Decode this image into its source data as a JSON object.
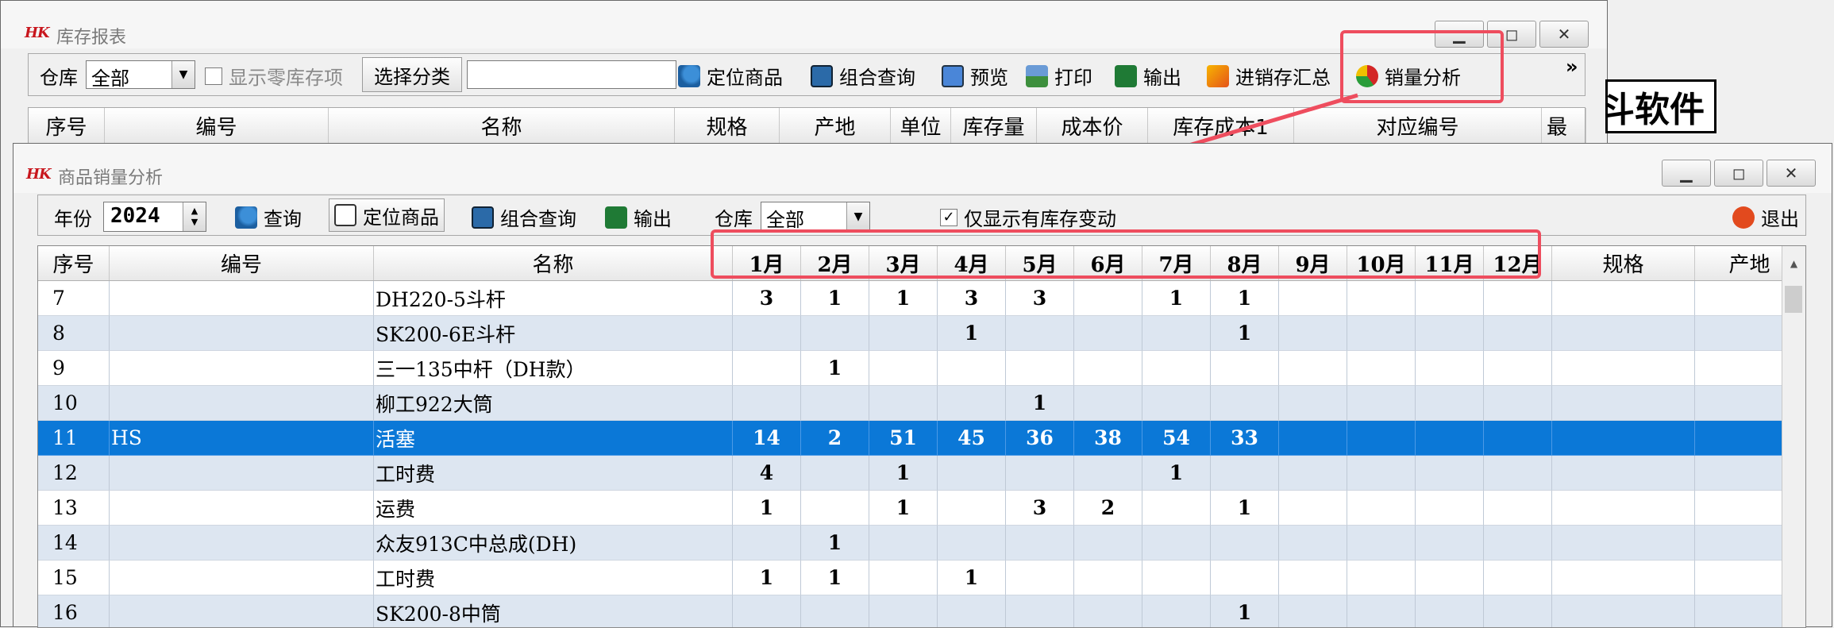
{
  "inventory_window": {
    "logo": "HK",
    "title": "库存报表",
    "toolbar": {
      "warehouse_label": "仓库",
      "warehouse_value": "全部",
      "show_zero_label": "显示零库存项",
      "choose_category": "选择分类",
      "category_value": "",
      "locate": "定位商品",
      "combo_query": "组合查询",
      "preview": "预览",
      "print": "打印",
      "export": "输出",
      "summary": "进销存汇总",
      "sales_analysis": "销量分析",
      "more": "»"
    },
    "columns": [
      "序号",
      "编号",
      "名称",
      "规格",
      "产地",
      "单位",
      "库存量",
      "成本价",
      "库存成本1",
      "对应编号",
      "最"
    ],
    "brand_text": "斗软件"
  },
  "sales_window": {
    "logo": "HK",
    "title": "商品销量分析",
    "toolbar": {
      "year_label": "年份",
      "year_value": "2024",
      "query": "查询",
      "locate": "定位商品",
      "combo_query": "组合查询",
      "export": "输出",
      "warehouse_label": "仓库",
      "warehouse_value": "全部",
      "only_changed_label": "仅显示有库存变动",
      "only_changed_checked": true,
      "exit": "退出"
    },
    "columns": {
      "index": "序号",
      "code": "编号",
      "name": "名称",
      "months": [
        "1月",
        "2月",
        "3月",
        "4月",
        "5月",
        "6月",
        "7月",
        "8月",
        "9月",
        "10月",
        "11月",
        "12月"
      ],
      "spec": "规格",
      "origin": "产地"
    },
    "rows": [
      {
        "index": "7",
        "code": "",
        "name": "DH220-5斗杆",
        "m": [
          "3",
          "1",
          "1",
          "3",
          "3",
          "",
          "1",
          "1",
          "",
          "",
          "",
          ""
        ]
      },
      {
        "index": "8",
        "code": "",
        "name": "SK200-6E斗杆",
        "m": [
          "",
          "",
          "",
          "1",
          "",
          "",
          "",
          "1",
          "",
          "",
          "",
          ""
        ]
      },
      {
        "index": "9",
        "code": "",
        "name": "三一135中杆（DH款）",
        "m": [
          "",
          "1",
          "",
          "",
          "",
          "",
          "",
          "",
          "",
          "",
          "",
          ""
        ]
      },
      {
        "index": "10",
        "code": "",
        "name": "柳工922大筒",
        "m": [
          "",
          "",
          "",
          "",
          "1",
          "",
          "",
          "",
          "",
          "",
          "",
          ""
        ]
      },
      {
        "index": "11",
        "code": "HS",
        "name": "活塞",
        "m": [
          "14",
          "2",
          "51",
          "45",
          "36",
          "38",
          "54",
          "33",
          "",
          "",
          "",
          ""
        ],
        "selected": true
      },
      {
        "index": "12",
        "code": "",
        "name": "工时费",
        "m": [
          "4",
          "",
          "1",
          "",
          "",
          "",
          "1",
          "",
          "",
          "",
          "",
          ""
        ]
      },
      {
        "index": "13",
        "code": "",
        "name": "运费",
        "m": [
          "1",
          "",
          "1",
          "",
          "3",
          "2",
          "",
          "1",
          "",
          "",
          "",
          ""
        ]
      },
      {
        "index": "14",
        "code": "",
        "name": "众友913C中总成(DH)",
        "m": [
          "",
          "1",
          "",
          "",
          "",
          "",
          "",
          "",
          "",
          "",
          "",
          ""
        ]
      },
      {
        "index": "15",
        "code": "",
        "name": "工时费",
        "m": [
          "1",
          "1",
          "",
          "1",
          "",
          "",
          "",
          "",
          "",
          "",
          "",
          ""
        ]
      },
      {
        "index": "16",
        "code": "",
        "name": "SK200-8中筒",
        "m": [
          "",
          "",
          "",
          "",
          "",
          "",
          "",
          "1",
          "",
          "",
          "",
          ""
        ]
      }
    ]
  },
  "colors": {
    "highlight": "#ee4d5e",
    "selected_row": "#0b78d7",
    "row_alt": "#dde6f1",
    "row_base": "#ffffff"
  }
}
